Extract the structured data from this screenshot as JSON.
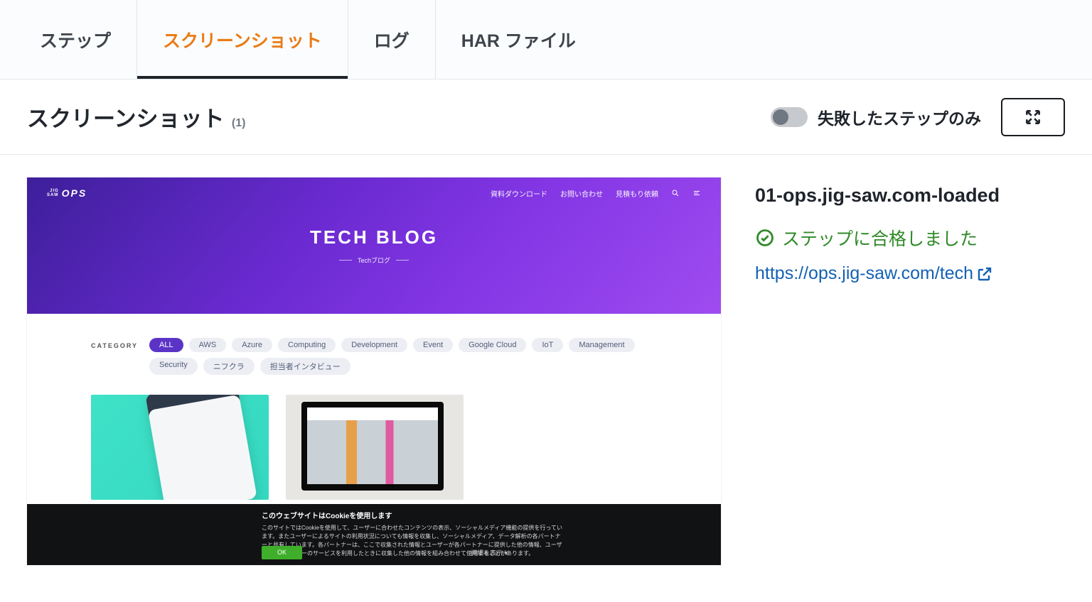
{
  "tabs": {
    "steps": "ステップ",
    "screenshots": "スクリーンショット",
    "logs": "ログ",
    "har": "HAR ファイル"
  },
  "header": {
    "title": "スクリーンショット",
    "count": "(1)",
    "toggle_label": "失敗したステップのみ"
  },
  "shot": {
    "nav": {
      "logo_top": "JIG",
      "logo_bottom": "SAW",
      "logo_main": "OPS",
      "links": {
        "download": "資料ダウンロード",
        "contact": "お問い合わせ",
        "quote": "見積もり依頼"
      }
    },
    "hero_title": "TECH BLOG",
    "hero_sub": "Techブログ",
    "category_label": "CATEGORY",
    "categories": [
      "ALL",
      "AWS",
      "Azure",
      "Computing",
      "Development",
      "Event",
      "Google Cloud",
      "IoT",
      "Management",
      "Security",
      "ニフクラ",
      "担当者インタビュー"
    ],
    "cookie": {
      "heading": "このウェブサイトはCookieを使用します",
      "body": "このサイトではCookieを使用して、ユーザーに合わせたコンテンツの表示、ソーシャルメディア機能の提供を行っています。またユーザーによるサイトの利用状況についても情報を収集し、ソーシャルメディア、データ解析の各パートナーと共有しています。各パートナーは、ここで収集された情報とユーザーが各パートナーに提供した他の情報、ユーザーが各パートナーのサービスを利用したときに収集した他の情報を組み合わせて使用することがあります。",
      "ok": "OK",
      "detail": "詳細を表示 ▾"
    }
  },
  "info": {
    "name": "01-ops.jig-saw.com-loaded",
    "pass": "ステップに合格しました",
    "url": "https://ops.jig-saw.com/tech"
  }
}
